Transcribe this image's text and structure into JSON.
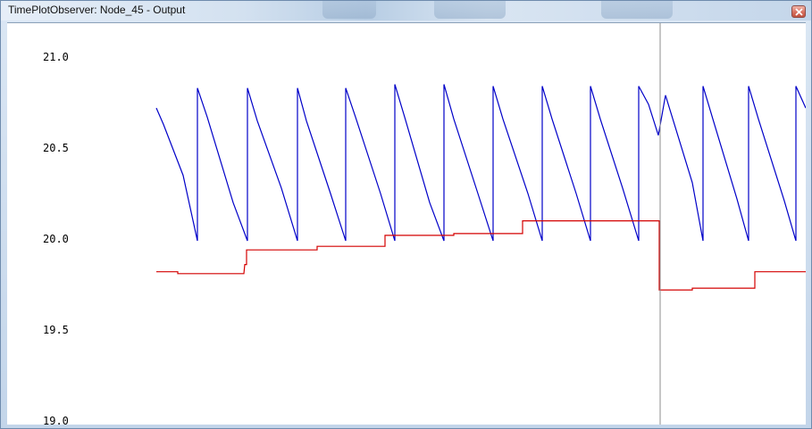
{
  "window": {
    "title": "TimePlotObserver: Node_45 - Output"
  },
  "chart_data": {
    "type": "line",
    "title": "",
    "xlabel": "",
    "ylabel": "",
    "ylim": [
      19.0,
      21.0
    ],
    "y_ticks": [
      "21.0",
      "20.5",
      "20.0",
      "19.5",
      "19.0"
    ],
    "grid": false,
    "legend": "none",
    "cursor_line": true,
    "series": [
      {
        "color": "#0000c8",
        "x": [
          0,
          8,
          30,
          46,
          46,
          57,
          86,
          102,
          102,
          113,
          140,
          158,
          158,
          168,
          195,
          212,
          212,
          223,
          251,
          267,
          267,
          278,
          306,
          322,
          322,
          333,
          360,
          377,
          377,
          388,
          416,
          432,
          432,
          443,
          470,
          486,
          486,
          497,
          522,
          540,
          540,
          551,
          562,
          570,
          600,
          612,
          612,
          623,
          650,
          663,
          663,
          674,
          703,
          716,
          716,
          727
        ],
        "values": [
          20.72,
          20.63,
          20.35,
          19.99,
          20.83,
          20.67,
          20.2,
          19.99,
          20.83,
          20.65,
          20.28,
          19.99,
          20.83,
          20.65,
          20.25,
          19.99,
          20.83,
          20.67,
          20.25,
          19.99,
          20.85,
          20.67,
          20.2,
          19.99,
          20.85,
          20.66,
          20.25,
          19.99,
          20.84,
          20.66,
          20.25,
          19.99,
          20.84,
          20.66,
          20.25,
          19.99,
          20.84,
          20.66,
          20.28,
          19.99,
          20.84,
          20.74,
          20.57,
          20.79,
          20.31,
          19.99,
          20.84,
          20.66,
          20.22,
          19.99,
          20.84,
          20.66,
          20.21,
          19.99,
          20.84,
          20.72
        ]
      },
      {
        "color": "#d40000",
        "x": [
          0,
          24,
          24,
          98,
          99,
          101,
          101,
          180,
          180,
          256,
          256,
          333,
          333,
          410,
          410,
          563,
          563,
          600,
          600,
          670,
          670,
          727
        ],
        "values": [
          19.82,
          19.82,
          19.81,
          19.81,
          19.86,
          19.86,
          19.94,
          19.94,
          19.96,
          19.96,
          20.02,
          20.02,
          20.03,
          20.03,
          20.1,
          20.1,
          19.72,
          19.72,
          19.73,
          19.73,
          19.82,
          19.82
        ]
      }
    ]
  }
}
